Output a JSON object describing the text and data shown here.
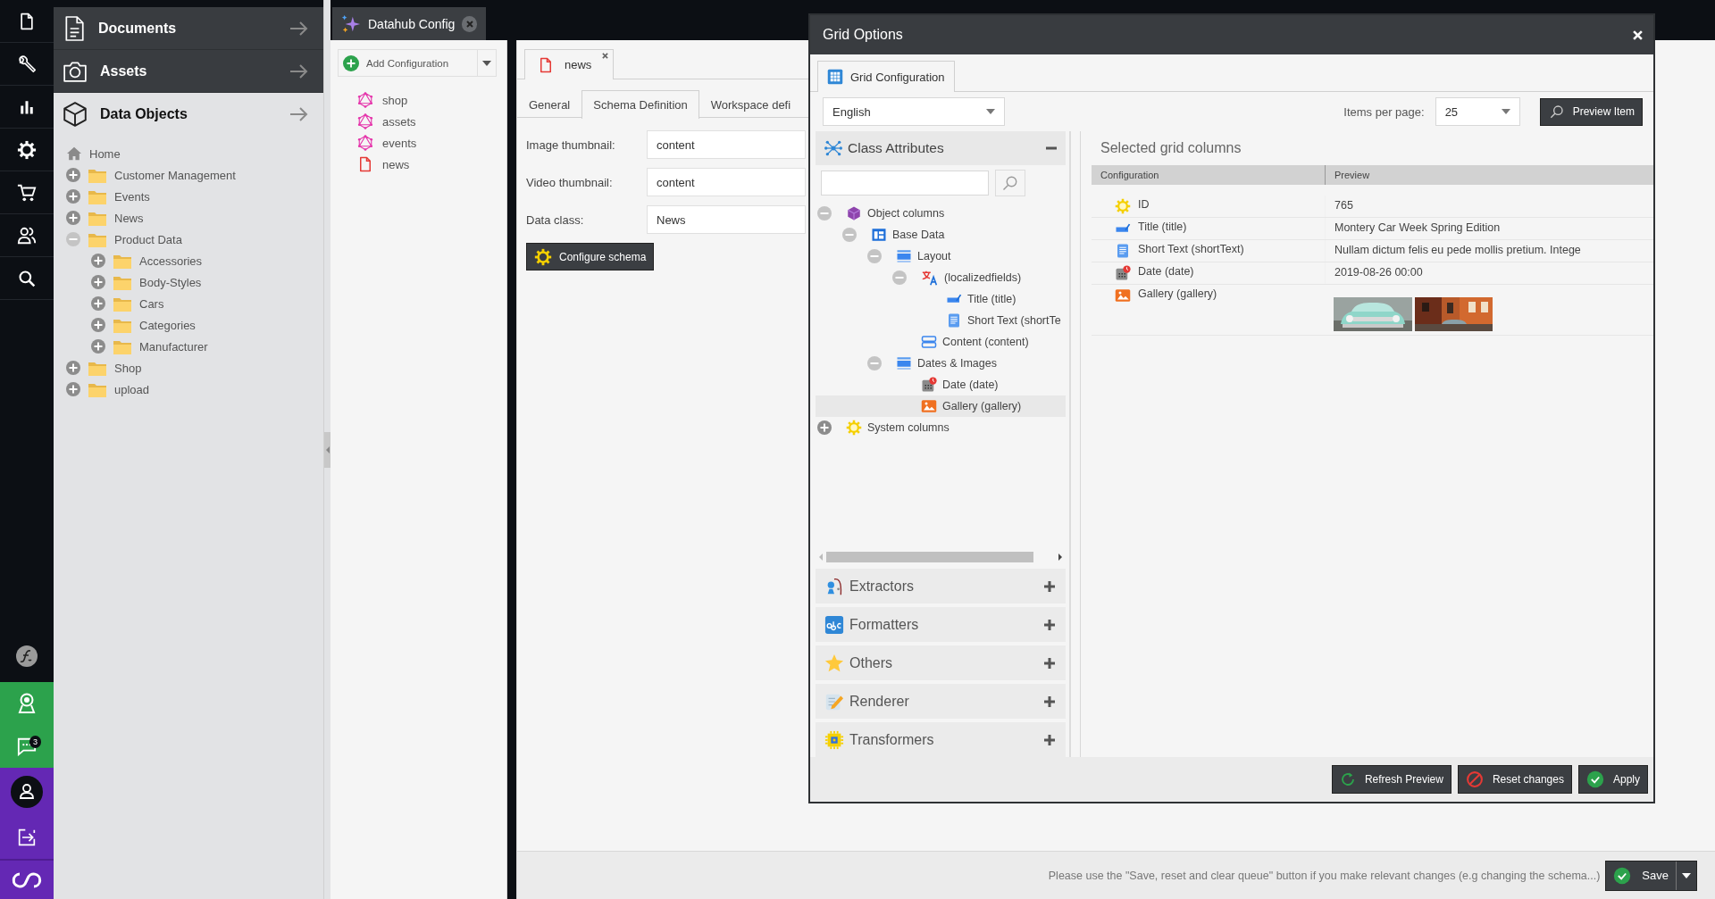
{
  "rail": {
    "chat_badge": "3"
  },
  "navigation": {
    "sections": [
      {
        "label": "Documents",
        "kind": "document",
        "selected": false
      },
      {
        "label": "Assets",
        "kind": "asset",
        "selected": false
      },
      {
        "label": "Data Objects",
        "kind": "object",
        "selected": true
      }
    ],
    "tree": [
      {
        "label": "Home",
        "kind": "home"
      },
      {
        "label": "Customer Management",
        "kind": "folder",
        "expanded": false
      },
      {
        "label": "Events",
        "kind": "folder",
        "expanded": false
      },
      {
        "label": "News",
        "kind": "folder",
        "expanded": false
      },
      {
        "label": "Product Data",
        "kind": "folder",
        "expanded": true,
        "children": [
          {
            "label": "Accessories",
            "kind": "folder",
            "expanded": false
          },
          {
            "label": "Body-Styles",
            "kind": "folder",
            "expanded": false
          },
          {
            "label": "Cars",
            "kind": "folder",
            "expanded": false
          },
          {
            "label": "Categories",
            "kind": "folder",
            "expanded": false
          },
          {
            "label": "Manufacturer",
            "kind": "folder",
            "expanded": false
          }
        ]
      },
      {
        "label": "Shop",
        "kind": "folder",
        "expanded": false
      },
      {
        "label": "upload",
        "kind": "folder",
        "expanded": false
      }
    ]
  },
  "app_tab": {
    "title": "Datahub Config"
  },
  "configs": {
    "add_label": "Add Configuration",
    "items": [
      {
        "label": "shop",
        "kind": "graphql"
      },
      {
        "label": "assets",
        "kind": "graphql"
      },
      {
        "label": "events",
        "kind": "graphql"
      },
      {
        "label": "news",
        "kind": "document"
      }
    ]
  },
  "editor": {
    "tab": "news",
    "subtabs": [
      {
        "label": "General",
        "selected": false
      },
      {
        "label": "Schema Definition",
        "selected": true
      },
      {
        "label": "Workspace defi",
        "selected": false
      }
    ],
    "fields": [
      {
        "label": "Image thumbnail:",
        "value": "content"
      },
      {
        "label": "Video thumbnail:",
        "value": "content"
      },
      {
        "label": "Data class:",
        "value": "News"
      }
    ],
    "configure_button": "Configure schema"
  },
  "status_bar": {
    "message": "Please use the \"Save, reset and clear queue\" button if you make relevant changes (e.g changing the schema...)",
    "save_label": "Save"
  },
  "dialog": {
    "title": "Grid Options",
    "tab": {
      "label": "Grid Configuration",
      "selected": true
    },
    "language": "English",
    "items_per_page_label": "Items per page:",
    "items_per_page": "25",
    "preview_button": "Preview Item",
    "class_attributes": {
      "title": "Class Attributes",
      "expanded": true,
      "tree": [
        {
          "label": "Object columns",
          "kind": "object",
          "expanded": true,
          "selected": false,
          "children": [
            {
              "label": "Base Data",
              "kind": "panel",
              "expanded": true,
              "selected": false,
              "children": [
                {
                  "label": "Layout",
                  "kind": "layout",
                  "expanded": true,
                  "selected": false,
                  "children": [
                    {
                      "label": "(localizedfields)",
                      "kind": "localized",
                      "expanded": true,
                      "selected": false,
                      "children": [
                        {
                          "label": "Title (title)",
                          "kind": "input",
                          "selected": false
                        },
                        {
                          "label": "Short Text (shortTe",
                          "kind": "textarea",
                          "selected": false
                        }
                      ]
                    },
                    {
                      "label": "Content (content)",
                      "kind": "wysiwyg",
                      "selected": false
                    }
                  ]
                },
                {
                  "label": "Dates & Images",
                  "kind": "layout",
                  "expanded": true,
                  "selected": false,
                  "children": [
                    {
                      "label": "Date (date)",
                      "kind": "date",
                      "selected": false
                    },
                    {
                      "label": "Gallery (gallery)",
                      "kind": "gallery",
                      "selected": true
                    }
                  ]
                }
              ]
            }
          ]
        },
        {
          "label": "System columns",
          "kind": "system",
          "expanded": false,
          "selected": false
        }
      ]
    },
    "panels": [
      {
        "label": "Extractors",
        "kind": "extractor",
        "expanded": false
      },
      {
        "label": "Formatters",
        "kind": "formatter",
        "expanded": false
      },
      {
        "label": "Others",
        "kind": "other",
        "expanded": false
      },
      {
        "label": "Renderer",
        "kind": "renderer",
        "expanded": false
      },
      {
        "label": "Transformers",
        "kind": "transformer",
        "expanded": false
      }
    ],
    "grid": {
      "title": "Selected grid columns",
      "columns": [
        "Configuration",
        "Preview"
      ],
      "rows": [
        {
          "kind": "system",
          "configuration": "ID",
          "preview": "765"
        },
        {
          "kind": "input",
          "configuration": "Title (title)",
          "preview": "Montery Car Week Spring Edition"
        },
        {
          "kind": "textarea",
          "configuration": "Short Text (shortText)",
          "preview": "Nullam dictum felis eu pede mollis pretium. Intege"
        },
        {
          "kind": "date",
          "configuration": "Date (date)",
          "preview": "2019-08-26 00:00"
        },
        {
          "kind": "gallery",
          "configuration": "Gallery (gallery)"
        }
      ]
    },
    "buttons": [
      {
        "label": "Refresh Preview",
        "kind": "refresh"
      },
      {
        "label": "Reset changes",
        "kind": "reset"
      },
      {
        "label": "Apply",
        "kind": "apply"
      }
    ]
  }
}
